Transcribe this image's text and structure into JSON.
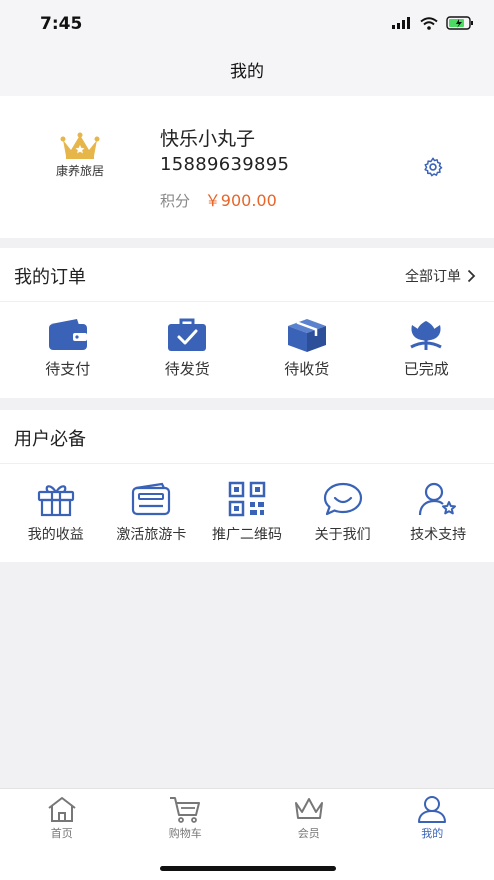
{
  "status": {
    "time": "7:45"
  },
  "nav": {
    "title": "我的"
  },
  "profile": {
    "logo_text": "康养旅居",
    "name": "快乐小丸子",
    "phone": "15889639895",
    "points_label": "积分",
    "points_value": "￥900.00"
  },
  "orders": {
    "title": "我的订单",
    "all_label": "全部订单",
    "items": [
      {
        "label": "待支付",
        "icon": "wallet-icon"
      },
      {
        "label": "待发货",
        "icon": "briefcase-check-icon"
      },
      {
        "label": "待收货",
        "icon": "box-icon"
      },
      {
        "label": "已完成",
        "icon": "flower-icon"
      }
    ]
  },
  "tools": {
    "title": "用户必备",
    "items": [
      {
        "label": "我的收益",
        "icon": "gift-icon"
      },
      {
        "label": "激活旅游卡",
        "icon": "card-icon"
      },
      {
        "label": "推广二维码",
        "icon": "qrcode-icon"
      },
      {
        "label": "关于我们",
        "icon": "chat-icon"
      },
      {
        "label": "技术支持",
        "icon": "user-star-icon"
      }
    ]
  },
  "tabs": [
    {
      "label": "首页",
      "icon": "home-icon"
    },
    {
      "label": "购物车",
      "icon": "cart-icon"
    },
    {
      "label": "会员",
      "icon": "crown-icon"
    },
    {
      "label": "我的",
      "icon": "person-icon"
    }
  ],
  "colors": {
    "accent": "#3a63b8",
    "points": "#e8652a",
    "crown": "#e7b64a"
  }
}
